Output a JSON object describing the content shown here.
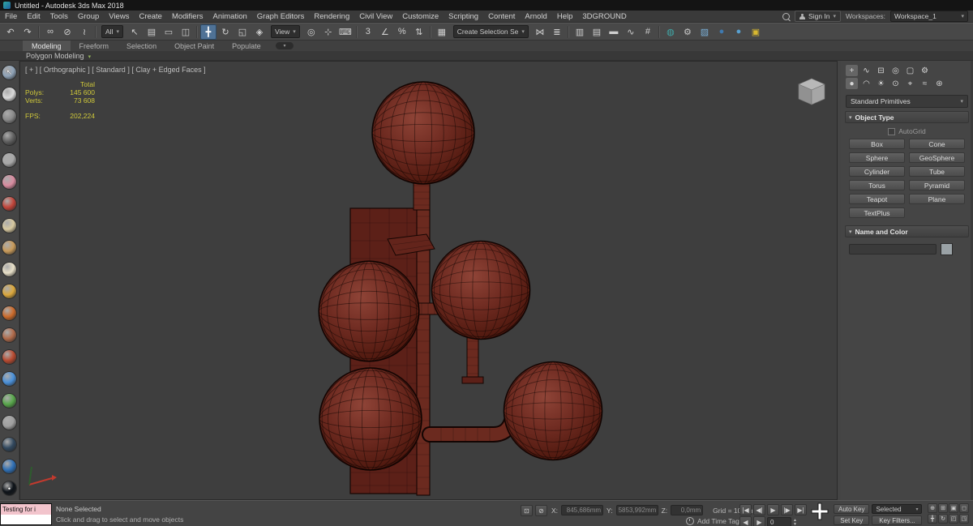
{
  "colors": {
    "model": "#6f2b21",
    "model_dark": "#461309",
    "accent": "#4f7296",
    "stats_text": "#cfc83a"
  },
  "title_bar": {
    "title": "Untitled - Autodesk 3ds Max 2018"
  },
  "menu_bar": {
    "items": [
      "File",
      "Edit",
      "Tools",
      "Group",
      "Views",
      "Create",
      "Modifiers",
      "Animation",
      "Graph Editors",
      "Rendering",
      "Civil View",
      "Customize",
      "Scripting",
      "Content",
      "Arnold",
      "Help",
      "3DGROUND"
    ],
    "sign_in": "Sign In",
    "workspaces_label": "Workspaces:",
    "workspace_value": "Workspace_1"
  },
  "main_toolbar": {
    "items": [
      {
        "t": "i",
        "name": "undo-button",
        "g": "↶"
      },
      {
        "t": "i",
        "name": "redo-button",
        "g": "↷"
      },
      {
        "t": "s",
        "name": "toolbar-separator"
      },
      {
        "t": "i",
        "name": "select-and-link-button",
        "g": "∞"
      },
      {
        "t": "i",
        "name": "unlink-selection-button",
        "g": "⊘"
      },
      {
        "t": "i",
        "name": "bind-to-space-warp-button",
        "g": "≀"
      },
      {
        "t": "s",
        "name": "toolbar-separator"
      },
      {
        "t": "d",
        "name": "selection-filter-dropdown",
        "label": "All"
      },
      {
        "t": "i",
        "name": "select-object-button",
        "g": "↖"
      },
      {
        "t": "i",
        "name": "select-by-name-button",
        "g": "▤"
      },
      {
        "t": "i",
        "name": "rectangular-selection-region-button",
        "g": "▭"
      },
      {
        "t": "i",
        "name": "window-crossing-toggle",
        "g": "◫"
      },
      {
        "t": "s",
        "name": "toolbar-separator"
      },
      {
        "t": "i",
        "name": "select-and-move-button",
        "g": "╋",
        "active": true
      },
      {
        "t": "i",
        "name": "select-and-rotate-button",
        "g": "↻"
      },
      {
        "t": "i",
        "name": "select-and-scale-button",
        "g": "◱"
      },
      {
        "t": "i",
        "name": "select-and-place-button",
        "g": "◈"
      },
      {
        "t": "d",
        "name": "reference-coordinate-system-dropdown",
        "label": "View"
      },
      {
        "t": "i",
        "name": "use-pivot-point-center-button",
        "g": "◎"
      },
      {
        "t": "i",
        "name": "select-and-manipulate-button",
        "g": "⊹"
      },
      {
        "t": "i",
        "name": "keyboard-shortcut-override-toggle",
        "g": "⌨"
      },
      {
        "t": "s",
        "name": "toolbar-separator"
      },
      {
        "t": "i",
        "name": "snaps-toggle-3d",
        "g": "3"
      },
      {
        "t": "i",
        "name": "angle-snap-toggle",
        "g": "∠"
      },
      {
        "t": "i",
        "name": "percent-snap-toggle",
        "g": "%"
      },
      {
        "t": "i",
        "name": "spinner-snap-toggle",
        "g": "⇅"
      },
      {
        "t": "s",
        "name": "toolbar-separator"
      },
      {
        "t": "i",
        "name": "edit-named-selection-sets-button",
        "g": "▦"
      },
      {
        "t": "d",
        "name": "named-selection-sets-dropdown",
        "label": "Create Selection Se"
      },
      {
        "t": "i",
        "name": "mirror-button",
        "g": "⋈"
      },
      {
        "t": "i",
        "name": "align-button",
        "g": "≣"
      },
      {
        "t": "s",
        "name": "toolbar-separator"
      },
      {
        "t": "i",
        "name": "toggle-scene-explorer-button",
        "g": "▥"
      },
      {
        "t": "i",
        "name": "toggle-layer-explorer-button",
        "g": "▤"
      },
      {
        "t": "i",
        "name": "toggle-ribbon-button",
        "g": "▬"
      },
      {
        "t": "i",
        "name": "curve-editor-button",
        "g": "∿"
      },
      {
        "t": "i",
        "name": "schematic-view-button",
        "g": "#"
      },
      {
        "t": "s",
        "name": "toolbar-separator"
      },
      {
        "t": "i",
        "name": "material-editor-button",
        "g": "◍",
        "c": "#3fa8a8"
      },
      {
        "t": "i",
        "name": "render-setup-button",
        "g": "⚙",
        "c": "#c8c8c8"
      },
      {
        "t": "i",
        "name": "rendered-frame-window-button",
        "g": "▨",
        "c": "#7ab0d8"
      },
      {
        "t": "i",
        "name": "render-production-button",
        "g": "●",
        "c": "#3f7ab0"
      },
      {
        "t": "i",
        "name": "render-iterative-button",
        "g": "●",
        "c": "#58a0d0"
      },
      {
        "t": "i",
        "name": "open-in-viewport-button",
        "g": "▣",
        "c": "#d8b830"
      }
    ]
  },
  "ribbon": {
    "tabs": [
      {
        "name": "tab-modeling",
        "label": "Modeling",
        "active": true
      },
      {
        "name": "tab-freeform",
        "label": "Freeform"
      },
      {
        "name": "tab-selection",
        "label": "Selection"
      },
      {
        "name": "tab-object-paint",
        "label": "Object Paint"
      },
      {
        "name": "tab-populate",
        "label": "Populate"
      }
    ],
    "panel_label": "Polygon Modeling"
  },
  "left_toolbar": {
    "items": [
      {
        "name": "left-tool-pointer-icon",
        "c": "#8fa3b8",
        "g": "↖"
      },
      {
        "name": "left-tool-page-icon",
        "c": "#d9d9d9"
      },
      {
        "name": "left-tool-panel-icon",
        "c": "#8a8a8a"
      },
      {
        "name": "left-tool-dark-icon",
        "c": "#5f5f5f"
      },
      {
        "name": "left-tool-gray-sphere-icon",
        "c": "#a8a8a8"
      },
      {
        "name": "left-tool-pink-sphere-icon",
        "c": "#d98ca0"
      },
      {
        "name": "left-tool-red-sphere-icon",
        "c": "#c2453a"
      },
      {
        "name": "left-tool-beige-sphere-icon",
        "c": "#d8c9a0"
      },
      {
        "name": "left-tool-tan-sphere-icon",
        "c": "#c89a5a"
      },
      {
        "name": "left-tool-cream-sphere-icon",
        "c": "#e8e0c8"
      },
      {
        "name": "left-tool-amber-sphere-icon",
        "c": "#dca83c"
      },
      {
        "name": "left-tool-orange-sphere-icon",
        "c": "#cc6a2a"
      },
      {
        "name": "left-tool-dots-icon",
        "c": "#b06a4a"
      },
      {
        "name": "left-tool-rust-sphere-icon",
        "c": "#b84a30"
      },
      {
        "name": "left-tool-blue-sphere-icon",
        "c": "#4a90d9"
      },
      {
        "name": "left-tool-green-sphere-icon",
        "c": "#57a64a"
      },
      {
        "name": "left-tool-silver-sphere-icon",
        "c": "#9f9f9f"
      },
      {
        "name": "left-tool-navy-sphere-icon",
        "c": "#31485e"
      },
      {
        "name": "left-tool-blue-dot-icon",
        "c": "#2e6fb5"
      },
      {
        "name": "left-tool-active-icon",
        "c": "#0d1218",
        "g": "•"
      }
    ]
  },
  "viewport": {
    "label": "[ + ] [ Orthographic ] [ Standard ] [ Clay + Edged Faces ]",
    "stats": {
      "total_label": "Total",
      "polys_label": "Polys:",
      "polys_value": "145 600",
      "verts_label": "Verts:",
      "verts_value": "73 608",
      "fps_label": "FPS:",
      "fps_value": "202,224"
    }
  },
  "command_panel": {
    "tabs_row1": [
      {
        "name": "create-tab",
        "g": "+",
        "active": true
      },
      {
        "name": "modify-tab",
        "g": "∿"
      },
      {
        "name": "hierarchy-tab",
        "g": "⊟"
      },
      {
        "name": "motion-tab",
        "g": "◎"
      },
      {
        "name": "display-tab",
        "g": "▢"
      },
      {
        "name": "utilities-tab",
        "g": "⚙"
      }
    ],
    "tabs_row2": [
      {
        "name": "geometry-category-tab",
        "g": "●",
        "active": true
      },
      {
        "name": "shapes-category-tab",
        "g": "◠"
      },
      {
        "name": "lights-category-tab",
        "g": "☀"
      },
      {
        "name": "cameras-category-tab",
        "g": "⊙"
      },
      {
        "name": "helpers-category-tab",
        "g": "⌖"
      },
      {
        "name": "space-warps-category-tab",
        "g": "≈"
      },
      {
        "name": "systems-category-tab",
        "g": "⊛"
      }
    ],
    "category_dropdown": "Standard Primitives",
    "object_type": {
      "title": "Object Type",
      "autogrid_label": "AutoGrid",
      "buttons": [
        "Box",
        "Cone",
        "Sphere",
        "GeoSphere",
        "Cylinder",
        "Tube",
        "Torus",
        "Pyramid",
        "Teapot",
        "Plane",
        "TextPlus"
      ]
    },
    "name_color": {
      "title": "Name and Color",
      "name_value": "",
      "swatch_color": "#9aa2a6"
    }
  },
  "status_bar": {
    "listener": {
      "macro_text": "Testing for i"
    },
    "prompt": "None Selected",
    "hint": "Click and drag to select and move objects",
    "mid_buttons": [
      {
        "name": "isolate-selection-toggle",
        "g": "⊡"
      },
      {
        "name": "selection-lock-toggle",
        "g": "⊘"
      }
    ],
    "coords": {
      "x_label": "X:",
      "x_value": "845,686mm",
      "y_label": "Y:",
      "y_value": "5853,992mm",
      "z_label": "Z:",
      "z_value": "0,0mm"
    },
    "grid_label": "Grid = 10,0mm",
    "add_time_tag": "Add Time Tag",
    "time_buttons": [
      {
        "name": "go-to-start-button",
        "g": "|◀"
      },
      {
        "name": "previous-frame-button",
        "g": "◀|"
      },
      {
        "name": "play-animation-button",
        "g": "▶"
      },
      {
        "name": "next-frame-button",
        "g": "|▶"
      },
      {
        "name": "go-to-end-button",
        "g": "▶|"
      }
    ],
    "frame_steppers": [
      {
        "name": "key-step-back-button",
        "g": "◀"
      },
      {
        "name": "key-step-forward-button",
        "g": "▶"
      }
    ],
    "frame_value": "0",
    "auto_key": "Auto Key",
    "set_key": "Set Key",
    "key_mode": "Selected",
    "key_filters": "Key Filters...",
    "nav_buttons": [
      {
        "name": "zoom-button",
        "g": "⊕"
      },
      {
        "name": "zoom-all-button",
        "g": "⊞"
      },
      {
        "name": "zoom-extents-button",
        "g": "▣"
      },
      {
        "name": "zoom-region-button",
        "g": "◻"
      },
      {
        "name": "pan-view-button",
        "g": "╋"
      },
      {
        "name": "orbit-button",
        "g": "↻"
      },
      {
        "name": "field-of-view-button",
        "g": "◰"
      },
      {
        "name": "maximize-viewport-toggle",
        "g": "◳"
      }
    ]
  }
}
